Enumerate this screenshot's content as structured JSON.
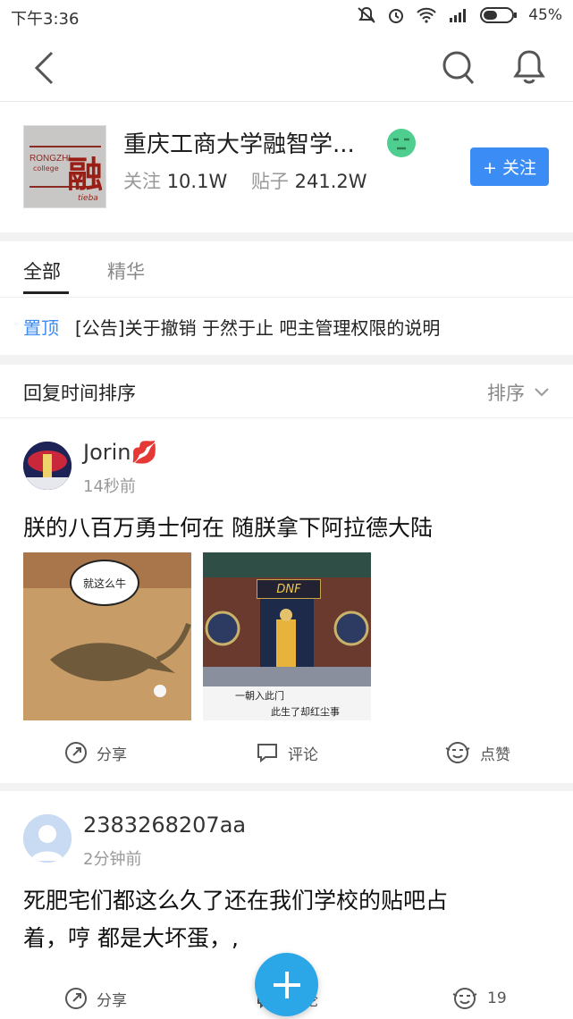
{
  "status": {
    "time": "下午3:36",
    "battery": "45%"
  },
  "nav": {
    "back_icon": "back-arrow-icon",
    "search_icon": "search-icon",
    "bell_icon": "bell-icon"
  },
  "forum": {
    "logo_text": "RONGZHI",
    "logo_sub": "college",
    "logo_char": "融",
    "logo_brand": "tieba",
    "title": "重庆工商大学融智学...",
    "follow_label": "关注",
    "follow_count": "10.1W",
    "posts_label": "贴子",
    "posts_count": "241.2W",
    "follow_button": "+ 关注"
  },
  "tabs": [
    {
      "label": "全部"
    },
    {
      "label": "精华"
    }
  ],
  "pinned": {
    "badge": "置顶",
    "text": "[公告]关于撤销 于然于止 吧主管理权限的说明"
  },
  "sort": {
    "label": "回复时间排序",
    "toggle": "排序"
  },
  "posts": [
    {
      "user": "Jorin💋",
      "time": "14秒前",
      "title": "朕的八百万勇士何在 随朕拿下阿拉德大陆",
      "images": [
        {
          "caption": "就这么牛"
        },
        {
          "banner": "DNF",
          "caption1": "一朝入此门",
          "caption2": "此生了却红尘事"
        }
      ],
      "share": "分享",
      "comment": "评论",
      "like": "点赞"
    },
    {
      "user": "2383268207aa",
      "time": "2分钟前",
      "title_line1": "死肥宅们都这么久了还在我们学校的贴吧占",
      "title_line2": "着，哼 都是大坏蛋，,",
      "share": "分享",
      "comment": "评论",
      "like": "19"
    }
  ],
  "colors": {
    "accent": "#3b8df5",
    "fab": "#2ba7e8"
  }
}
